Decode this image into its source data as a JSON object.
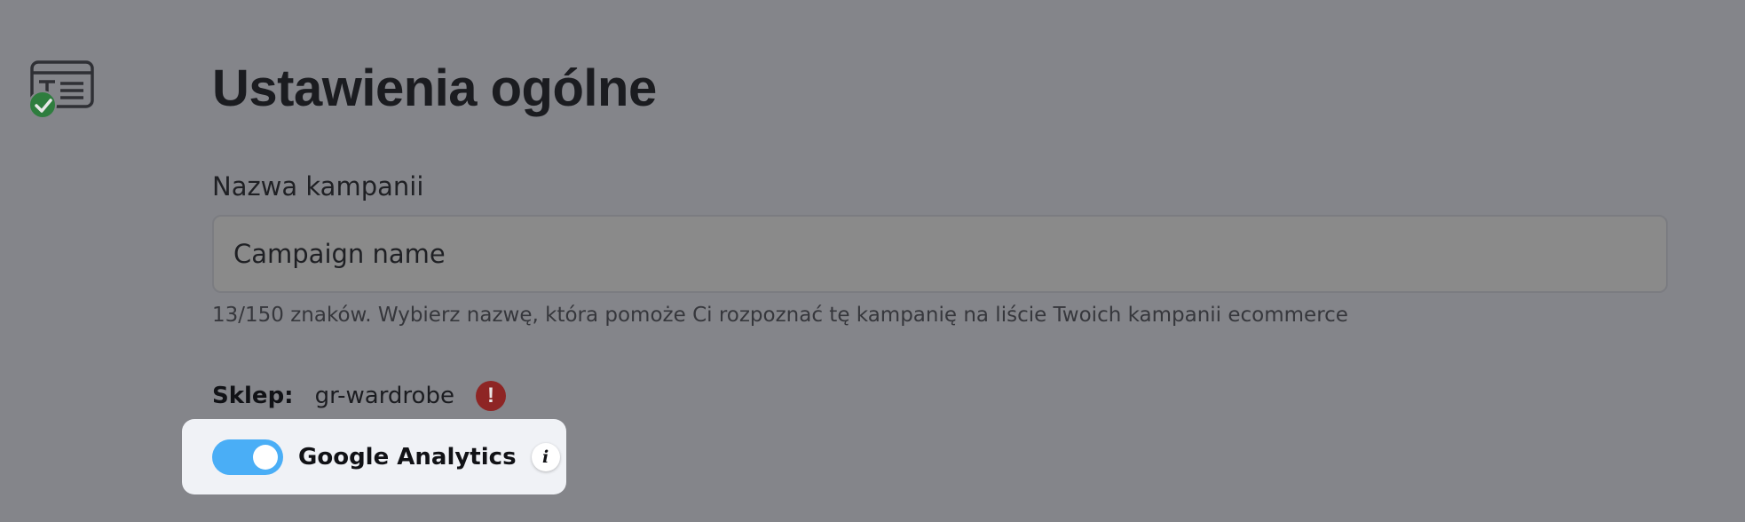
{
  "section": {
    "icon": "text-card-icon",
    "status_icon": "check-circle-icon",
    "status_color": "#2e7d3e"
  },
  "page": {
    "title": "Ustawienia ogólne"
  },
  "campaign_name": {
    "label": "Nazwa kampanii",
    "value": "Campaign name",
    "helper": "13/150 znaków. Wybierz nazwę, która pomoże Ci rozpoznać tę kampanię na liście Twoich kampanii ecommerce"
  },
  "shop": {
    "label": "Sklep:",
    "value": "gr-wardrobe",
    "alert_icon": "exclamation-circle-icon",
    "alert_glyph": "!",
    "alert_color": "#8e2524"
  },
  "google_analytics": {
    "label": "Google Analytics",
    "enabled": true,
    "toggle_color": "#4aaef6",
    "info_icon": "info-icon",
    "info_glyph": "i"
  },
  "colors": {
    "overlay_background": "#84858a",
    "card_background": "#f0f2f6"
  }
}
